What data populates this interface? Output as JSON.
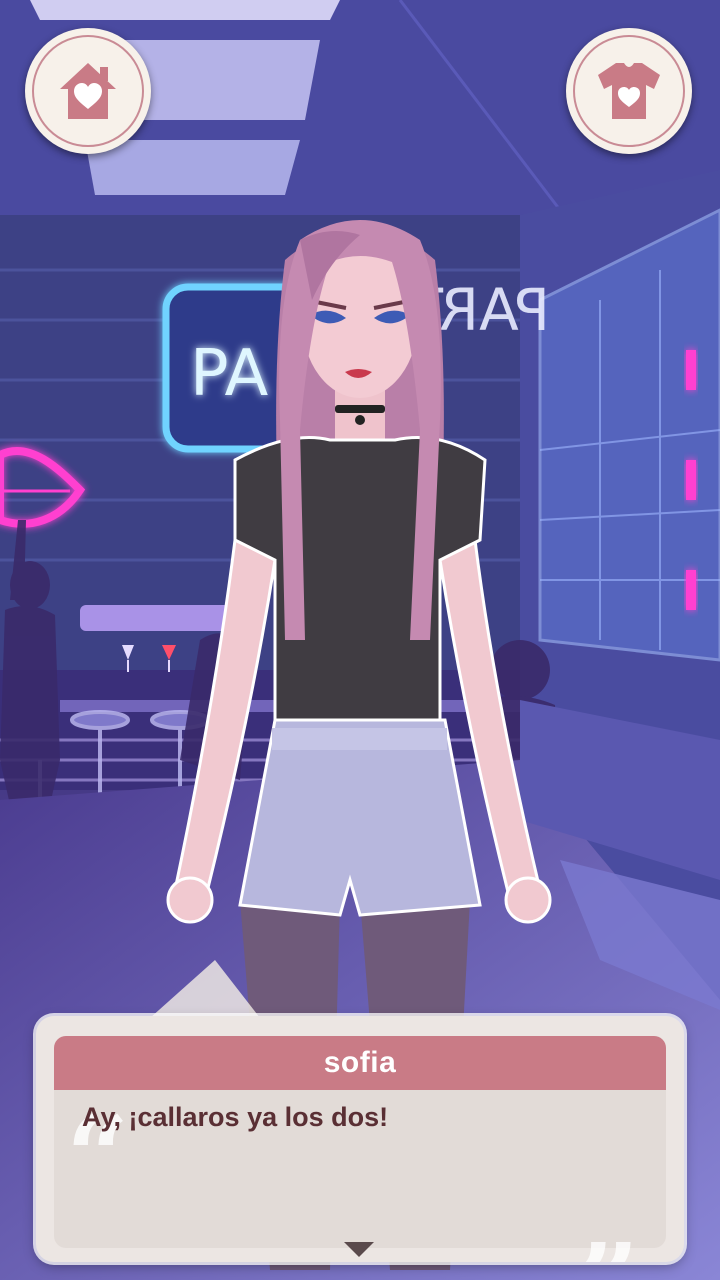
{
  "header": {
    "home_icon": "home-heart-icon",
    "outfit_icon": "tshirt-heart-icon"
  },
  "scene": {
    "neon_sign_left": "PA",
    "neon_sign_right": "PARTY"
  },
  "dialog": {
    "speaker": "sofia",
    "text": "Ay, ¡callaros ya los dos!"
  },
  "colors": {
    "accent_pink": "#c97b86",
    "dialog_bg": "#ece6e3",
    "text_dark": "#5a2f34",
    "neon_blue": "#6fd3ff",
    "neon_pink": "#ff3fd0"
  }
}
